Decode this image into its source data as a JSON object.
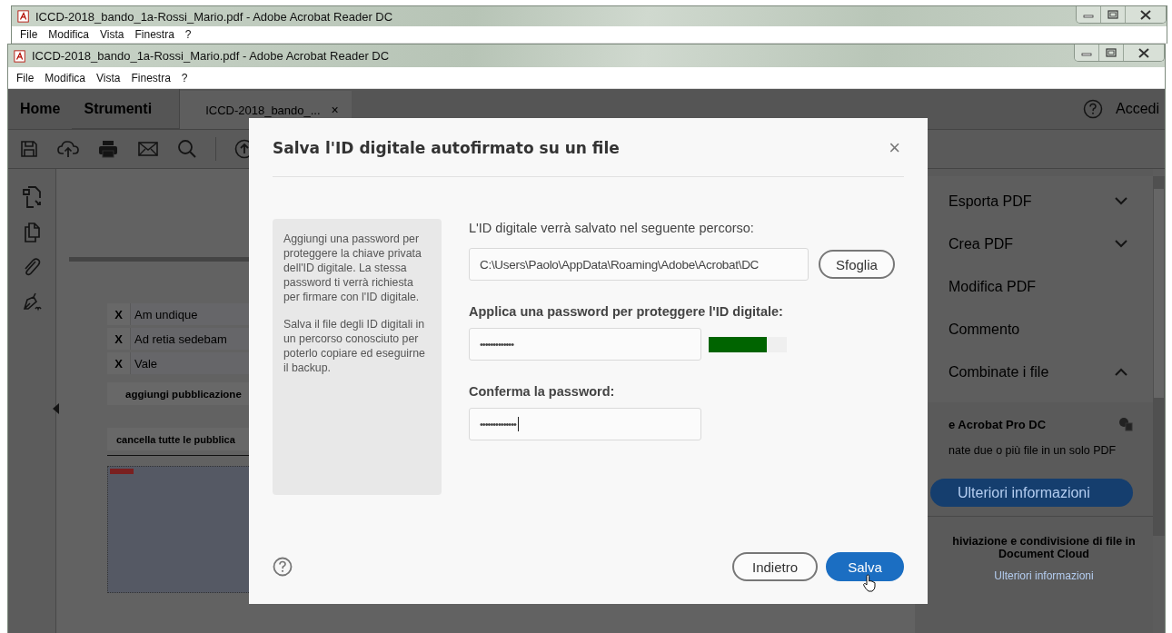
{
  "back_window": {
    "title": "ICCD-2018_bando_1a-Rossi_Mario.pdf - Adobe Acrobat Reader DC",
    "menu": [
      "File",
      "Modifica",
      "Vista",
      "Finestra",
      "?"
    ]
  },
  "window": {
    "title": "ICCD-2018_bando_1a-Rossi_Mario.pdf - Adobe Acrobat Reader DC",
    "menu": [
      "File",
      "Modifica",
      "Vista",
      "Finestra",
      "?"
    ]
  },
  "app_tabs": [
    {
      "label": "Home",
      "selected": false
    },
    {
      "label": "Strumenti",
      "selected": false
    },
    {
      "label": "ICCD-2018_bando_...",
      "selected": true,
      "close": "×"
    }
  ],
  "account": {
    "label": "Accedi"
  },
  "document": {
    "entries": [
      {
        "mark": "X",
        "text": "Am undique"
      },
      {
        "mark": "X",
        "text": "Ad retia sedebam"
      },
      {
        "mark": "X",
        "text": "Vale"
      }
    ],
    "buttons": [
      "aggiungi pubblicazione",
      "cancella tutte le pubblica"
    ]
  },
  "tools_panel": {
    "items": [
      {
        "kind": "group",
        "label": "Esporta PDF",
        "expanded": false
      },
      {
        "kind": "group",
        "label": "Crea PDF",
        "expanded": false
      },
      {
        "kind": "tool",
        "label": "Modifica PDF"
      },
      {
        "kind": "tool",
        "label": "Commento"
      },
      {
        "kind": "group",
        "label": "Combinate i file",
        "expanded": true
      }
    ],
    "promo": {
      "title": "e Acrobat Pro DC",
      "text": "nate due o più file in un solo PDF",
      "button": "Ulteriori informazioni"
    },
    "cloud": {
      "text": "hiviazione e condivisione di file in Document Cloud",
      "link": "Ulteriori informazioni"
    }
  },
  "dialog": {
    "title": "Salva l'ID digitale autofirmato su un file",
    "close": "×",
    "info": [
      "Aggiungi una password per proteggere la chiave privata dell'ID digitale. La stessa password ti verrà richiesta per firmare con l'ID digitale.",
      "Salva il file degli ID digitali in un percorso conosciuto per poterlo copiare ed eseguirne il backup."
    ],
    "path_label": "L'ID digitale verrà salvato nel seguente percorso:",
    "path_value": "C:\\Users\\Paolo\\AppData\\Roaming\\Adobe\\Acrobat\\DC",
    "browse": "Sfoglia",
    "password_label": "Applica una password per proteggere l'ID digitale:",
    "password_value": "•••••••••••••",
    "password_focused": false,
    "strength": {
      "level": 0.74,
      "color": "#006400"
    },
    "confirm_label": "Conferma la password:",
    "confirm_value": "••••••••••••••",
    "confirm_focused": true,
    "buttons": [
      {
        "kind": "secondary",
        "label": "Indietro"
      },
      {
        "kind": "primary",
        "label": "Salva"
      }
    ]
  }
}
